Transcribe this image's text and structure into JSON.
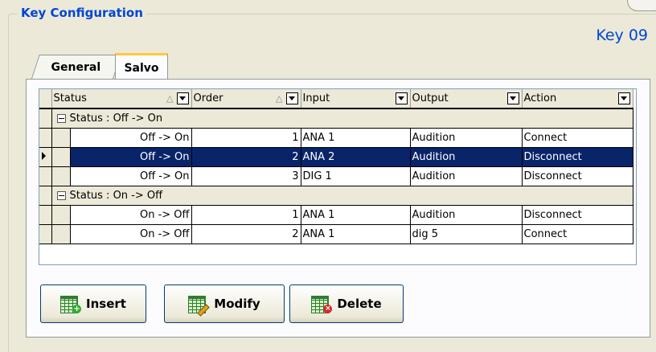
{
  "groupbox": {
    "title": "Key Configuration"
  },
  "key_title": "Key 09",
  "tabs": [
    {
      "label": "General",
      "active": false
    },
    {
      "label": "Salvo",
      "active": true
    }
  ],
  "grid": {
    "columns": [
      "Status",
      "Order",
      "Input",
      "Output",
      "Action"
    ],
    "groups": [
      {
        "label": "Status : Off -> On",
        "rows": [
          {
            "status": "Off -> On",
            "order": "1",
            "input": "ANA 1",
            "output": "Audition",
            "action": "Connect",
            "selected": false
          },
          {
            "status": "Off -> On",
            "order": "2",
            "input": "ANA 2",
            "output": "Audition",
            "action": "Disconnect",
            "selected": true
          },
          {
            "status": "Off -> On",
            "order": "3",
            "input": "DIG 1",
            "output": "Audition",
            "action": "Disconnect",
            "selected": false
          }
        ]
      },
      {
        "label": "Status : On -> Off",
        "rows": [
          {
            "status": "On -> Off",
            "order": "1",
            "input": "ANA 1",
            "output": "Audition",
            "action": "Disconnect",
            "selected": false
          },
          {
            "status": "On -> Off",
            "order": "2",
            "input": "ANA 1",
            "output": "dig 5",
            "action": "Connect",
            "selected": false
          }
        ]
      }
    ]
  },
  "buttons": {
    "insert": "Insert",
    "modify": "Modify",
    "delete": "Delete"
  },
  "colors": {
    "accent": "#0046d5",
    "selection": "#0a246a",
    "background": "#ece9d8"
  }
}
